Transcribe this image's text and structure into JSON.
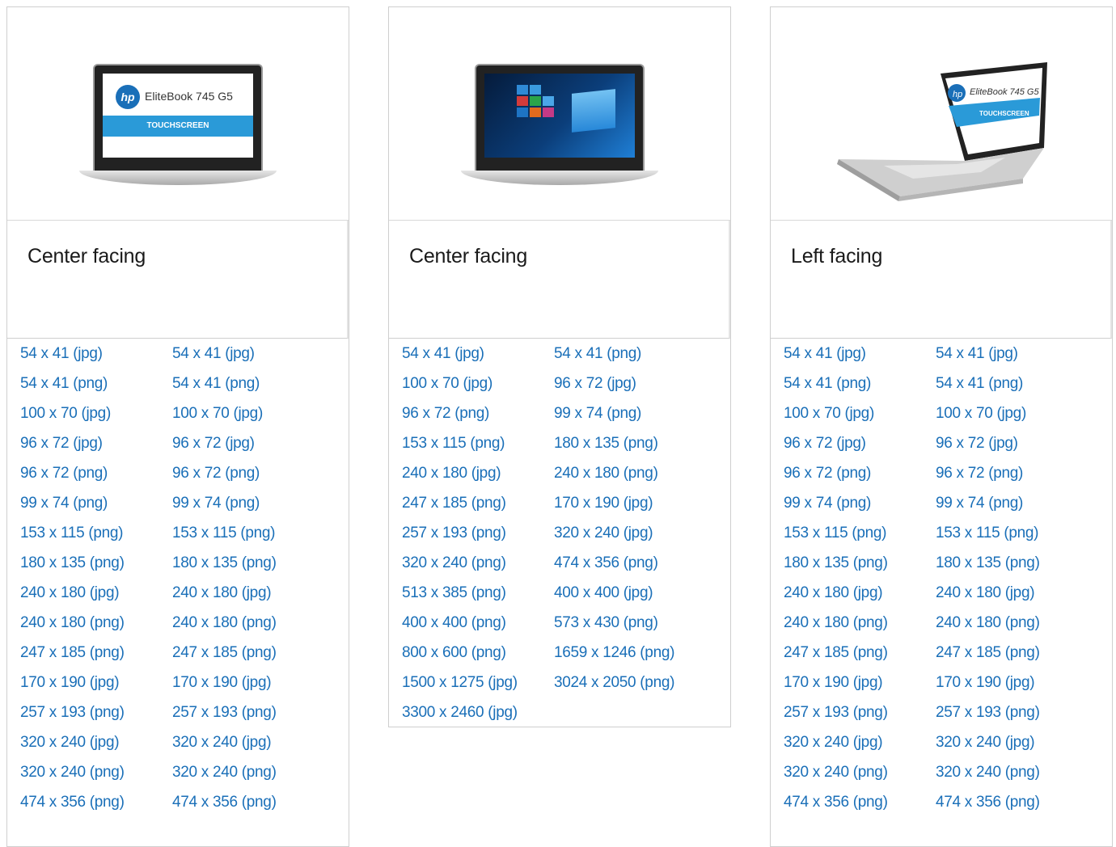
{
  "cards": [
    {
      "caption": "Center facing",
      "illustration": "laptop-front-touchscreen-icon",
      "screen_brand": "EliteBook 745 G5",
      "screen_banner": "TOUCHSCREEN",
      "links": [
        "54 x 41 (jpg)",
        "54 x 41 (jpg)",
        "54 x 41 (png)",
        "54 x 41 (png)",
        "100 x 70 (jpg)",
        "100 x 70 (jpg)",
        "96 x 72 (jpg)",
        "96 x 72 (jpg)",
        "96 x 72 (png)",
        "96 x 72 (png)",
        "99 x 74 (png)",
        "99 x 74 (png)",
        "153 x 115 (png)",
        "153 x 115 (png)",
        "180 x 135 (png)",
        "180 x 135 (png)",
        "240 x 180 (jpg)",
        "240 x 180 (jpg)",
        "240 x 180 (png)",
        "240 x 180 (png)",
        "247 x 185 (png)",
        "247 x 185 (png)",
        "170 x 190 (jpg)",
        "170 x 190 (jpg)",
        "257 x 193 (png)",
        "257 x 193 (png)",
        "320 x 240 (jpg)",
        "320 x 240 (jpg)",
        "320 x 240 (png)",
        "320 x 240 (png)",
        "474 x 356 (png)",
        "474 x 356 (png)"
      ]
    },
    {
      "caption": "Center facing",
      "illustration": "laptop-front-windows-icon",
      "links": [
        "54 x 41 (jpg)",
        "54 x 41 (png)",
        "100 x 70 (jpg)",
        "96 x 72 (jpg)",
        "96 x 72 (png)",
        "99 x 74 (png)",
        "153 x 115 (png)",
        "180 x 135 (png)",
        "240 x 180 (jpg)",
        "240 x 180 (png)",
        "247 x 185 (png)",
        "170 x 190 (jpg)",
        "257 x 193 (png)",
        "320 x 240 (jpg)",
        "320 x 240 (png)",
        "474 x 356 (png)",
        "513 x 385 (png)",
        "400 x 400 (jpg)",
        "400 x 400 (png)",
        "573 x 430 (png)",
        "800 x 600 (png)",
        "1659 x 1246 (png)",
        "1500 x 1275 (jpg)",
        "3024 x 2050 (png)",
        "3300 x 2460 (jpg)"
      ]
    },
    {
      "caption": "Left facing",
      "illustration": "laptop-left-facing-icon",
      "screen_brand": "EliteBook 745 G5",
      "screen_banner": "TOUCHSCREEN",
      "links": [
        "54 x 41 (jpg)",
        "54 x 41 (jpg)",
        "54 x 41 (png)",
        "54 x 41 (png)",
        "100 x 70 (jpg)",
        "100 x 70 (jpg)",
        "96 x 72 (jpg)",
        "96 x 72 (jpg)",
        "96 x 72 (png)",
        "96 x 72 (png)",
        "99 x 74 (png)",
        "99 x 74 (png)",
        "153 x 115 (png)",
        "153 x 115 (png)",
        "180 x 135 (png)",
        "180 x 135 (png)",
        "240 x 180 (jpg)",
        "240 x 180 (jpg)",
        "240 x 180 (png)",
        "240 x 180 (png)",
        "247 x 185 (png)",
        "247 x 185 (png)",
        "170 x 190 (jpg)",
        "170 x 190 (jpg)",
        "257 x 193 (png)",
        "257 x 193 (png)",
        "320 x 240 (jpg)",
        "320 x 240 (jpg)",
        "320 x 240 (png)",
        "320 x 240 (png)",
        "474 x 356 (png)",
        "474 x 356 (png)"
      ]
    }
  ],
  "colors": {
    "link": "#1a6fb8",
    "caption_text": "#1a1a1a",
    "border": "#cfcfcf",
    "hp_blue": "#1a6fb8",
    "banner_blue": "#2a9ad8"
  }
}
